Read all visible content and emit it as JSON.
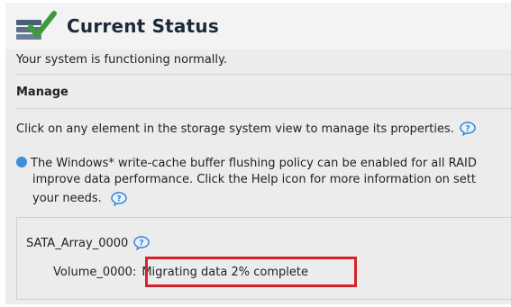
{
  "header": {
    "title": "Current Status",
    "icon": "status-check-icon"
  },
  "status": {
    "message": "Your system is functioning normally."
  },
  "manage": {
    "heading": "Manage",
    "instruction": "Click on any element in the storage system view to manage its properties.",
    "info_line1": "The Windows* write-cache buffer flushing policy can be enabled for all RAID",
    "info_line2": "improve data performance. Click the Help icon for more information on sett",
    "info_line3": "your needs."
  },
  "array": {
    "name": "SATA_Array_0000",
    "volume_label": "Volume_0000:",
    "volume_status": "Migrating data 2% complete"
  },
  "colors": {
    "highlight": "#d6222a",
    "info": "#3c8fd8",
    "help": "#2f7fd0"
  }
}
